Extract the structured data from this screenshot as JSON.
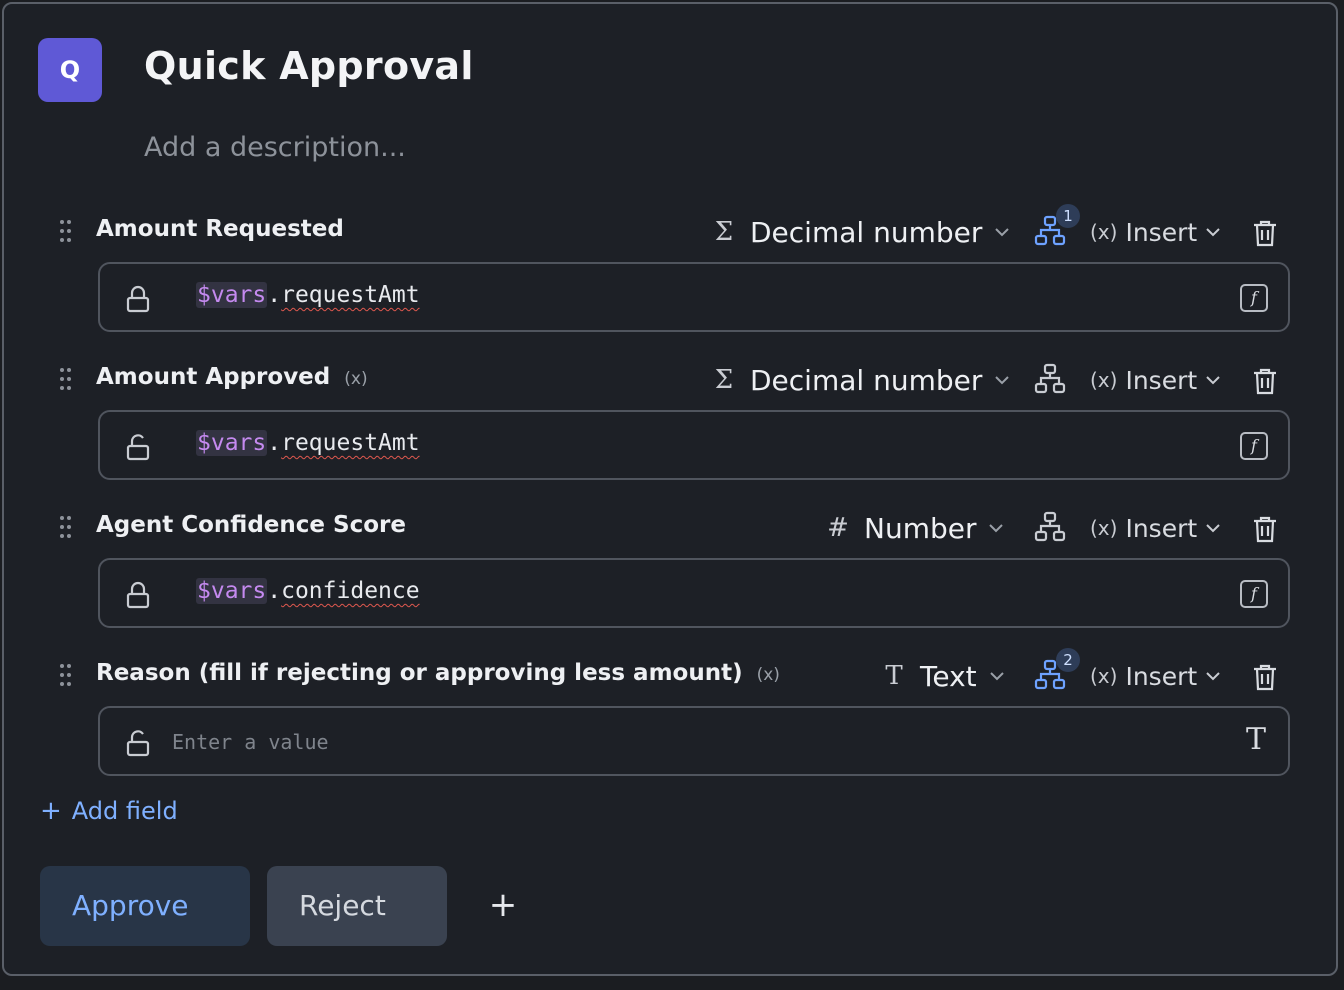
{
  "form": {
    "badge_letter": "Q",
    "title": "Quick Approval",
    "description_placeholder": "Add a description..."
  },
  "fields": [
    {
      "label": "Amount Requested",
      "type_icon": "Σ",
      "type": "Decimal number",
      "dependency_count": "1",
      "insert_label": "Insert",
      "value_var": "$vars",
      "value_dot": ".",
      "value_prop": "requestAmt"
    },
    {
      "label": "Amount Approved",
      "variable_marker": "(x)",
      "type_icon": "Σ",
      "type": "Decimal number",
      "insert_label": "Insert",
      "value_var": "$vars",
      "value_dot": ".",
      "value_prop": "requestAmt"
    },
    {
      "label": "Agent Confidence Score",
      "type_icon": "#",
      "type": "Number",
      "insert_label": "Insert",
      "value_var": "$vars",
      "value_dot": ".",
      "value_prop": "confidence"
    },
    {
      "label": "Reason (fill if rejecting or approving less amount)",
      "variable_marker": "(x)",
      "type_icon": "T",
      "type": "Text",
      "dependency_count": "2",
      "insert_label": "Insert",
      "value_placeholder": "Enter a value"
    }
  ],
  "add_field": {
    "icon": "+",
    "label": "Add field"
  },
  "actions": {
    "approve_label": "Approve",
    "reject_label": "Reject",
    "add_icon": "+"
  },
  "icons": {
    "insert_glyph": "(x)",
    "chevron": "⌄",
    "fx_glyph": "f",
    "text_glyph": "T"
  },
  "colors": {
    "background": "#1d2026",
    "accent_badge": "#5f59d6",
    "link_blue": "#7fb0ff",
    "variable_purple": "#c58af0",
    "approve_bg": "#283547",
    "reject_bg": "#3a4250"
  }
}
